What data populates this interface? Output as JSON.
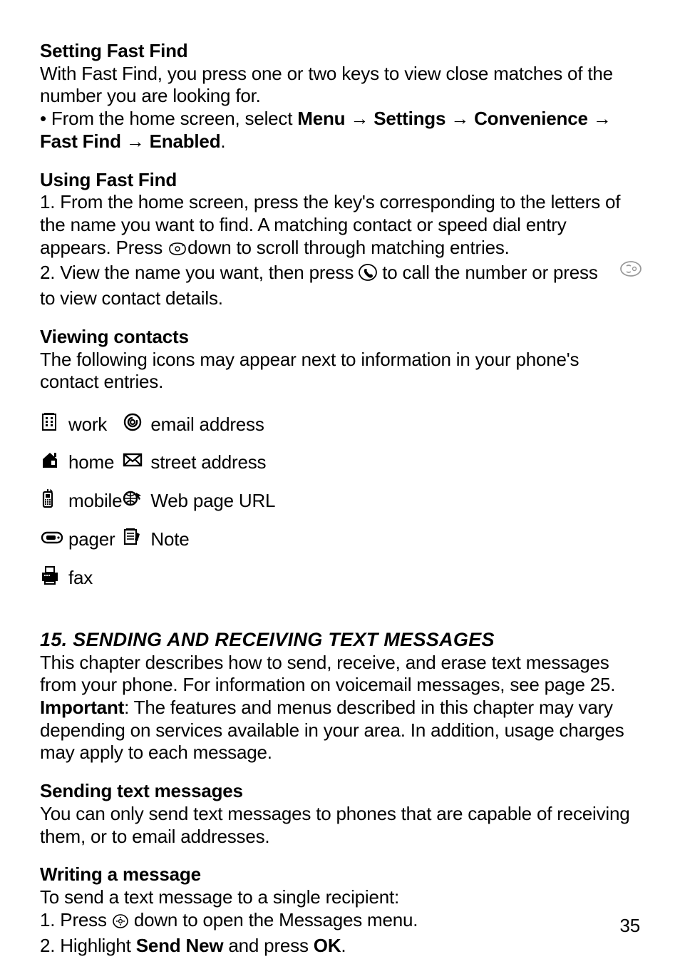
{
  "s1": {
    "h": "Setting Fast Find",
    "p1": "With Fast Find, you press one or two keys to view close matches of the number you are looking for.",
    "bullet_prefix": "• From the home screen, select ",
    "menu": "Menu",
    "settings": "Settings",
    "convenience": "Convenience",
    "fastfind": "Fast Find",
    "enabled": "Enabled",
    "period": "."
  },
  "s2": {
    "h": "Using Fast Find",
    "l1": "1. From the home screen, press the key's corresponding to the letters of the name you want to find. A matching contact or speed dial entry appears. Press ",
    "l1b": "down to scroll through matching entries.",
    "l2a": "2. View the name you want, then press ",
    "l2b": " to call the number or press ",
    "l2c": "to view contact details."
  },
  "s3": {
    "h": "Viewing contacts",
    "p": "The following icons may appear next to information in your phone's contact entries.",
    "rows": {
      "work": "work",
      "home": "home",
      "mobile": "mobile",
      "pager": "pager",
      "fax": "fax",
      "email": "email address",
      "street": "street address",
      "web": "Web page URL",
      "note": "Note"
    }
  },
  "s4": {
    "h": "15. SENDING AND RECEIVING TEXT MESSAGES",
    "p1": "This chapter describes how to send, receive, and erase text messages from your phone. For information on voicemail messages, see page 25.",
    "imp_label": "Important",
    "imp_rest": ": The features and menus described in this chapter may vary depending on services available in your area. In addition, usage charges may apply to each message."
  },
  "s5": {
    "h": "Sending text messages",
    "p": "You can only send text messages to phones that are capable of receiving them, or to email addresses."
  },
  "s6": {
    "h": "Writing a message",
    "l0": "To send a text message to a single recipient:",
    "l1a": "1. Press ",
    "l1b": " down to open the Messages menu.",
    "l2a": "2. Highlight ",
    "sendnew": "Send New",
    "l2b": " and press ",
    "ok": "OK",
    "l2c": "."
  },
  "arrow": "→",
  "pagenum": "35"
}
